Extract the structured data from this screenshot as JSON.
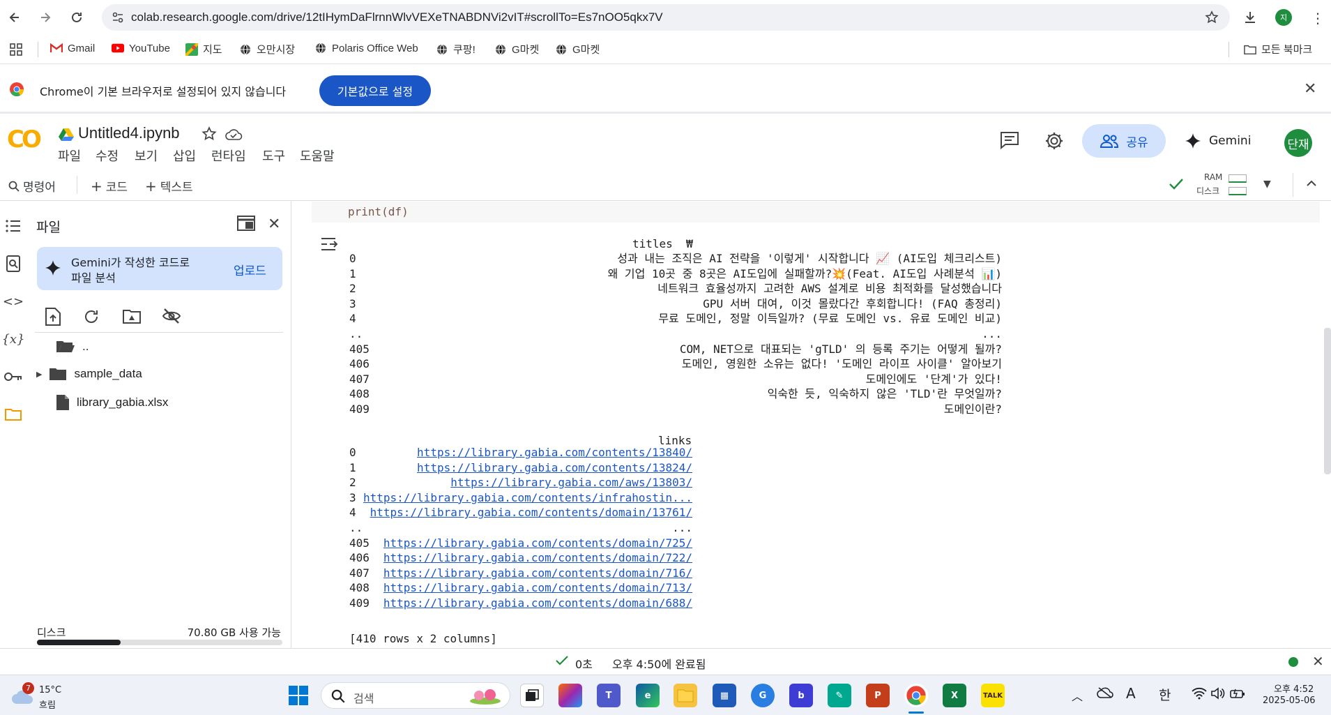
{
  "browser": {
    "url": "colab.research.google.com/drive/12tIHymDaFlrnnWlvVEXeTNABDNVi2vIT#scrollTo=Es7nOO5qkx7V",
    "profile_initial": "지"
  },
  "bookmarks": [
    {
      "label": "Gmail",
      "icon": "gmail-icon"
    },
    {
      "label": "YouTube",
      "icon": "youtube-icon"
    },
    {
      "label": "지도",
      "icon": "maps-icon"
    },
    {
      "label": "오만시장",
      "icon": "globe-icon"
    },
    {
      "label": "Polaris Office Web",
      "icon": "globe-icon"
    },
    {
      "label": "쿠팡!",
      "icon": "globe-icon"
    },
    {
      "label": "G마켓",
      "icon": "globe-icon"
    },
    {
      "label": "G마켓",
      "icon": "globe-icon"
    }
  ],
  "all_bookmarks_label": "모든 북마크",
  "infobar": {
    "message": "Chrome이 기본 브라우저로 설정되어 있지 않습니다",
    "button": "기본값으로 설정"
  },
  "colab": {
    "logo": "CO",
    "title": "Untitled4.ipynb",
    "menus": [
      "파일",
      "수정",
      "보기",
      "삽입",
      "런타임",
      "도구",
      "도움말"
    ],
    "share_label": "공유",
    "gemini_label": "Gemini",
    "avatar_label": "단재",
    "toolbar": {
      "command": "명령어",
      "code": "코드",
      "text": "텍스트",
      "ram": "RAM",
      "disk": "디스크"
    }
  },
  "sidebar": {
    "title": "파일",
    "gemini_card": {
      "line1": "Gemini가 작성한 코드로",
      "line2": "파일 분석",
      "upload": "업로드"
    },
    "tree": [
      {
        "name": "..",
        "type": "folder-open"
      },
      {
        "name": "sample_data",
        "type": "folder"
      },
      {
        "name": "library_gabia.xlsx",
        "type": "file"
      }
    ],
    "disk_label": "디스크",
    "disk_available": "70.80 GB 사용 가능",
    "disk_used_fraction": 0.34
  },
  "cell": {
    "code_line": "print(df)",
    "titles_header": "titles  ₩",
    "titles": [
      {
        "idx": "0",
        "text": "성과 내는 조직은 AI 전략을 '이렇게' 시작합니다 📈 (AI도입 체크리스트)"
      },
      {
        "idx": "1",
        "text": "왜 기업 10곳 중 8곳은 AI도입에 실패할까?💥(Feat. AI도입 사례분석 📊)"
      },
      {
        "idx": "2",
        "text": "네트워크 효율성까지 고려한 AWS 설계로 비용 최적화를 달성했습니다"
      },
      {
        "idx": "3",
        "text": "GPU 서버 대여, 이것 몰랐다간 후회합니다! (FAQ 총정리)"
      },
      {
        "idx": "4",
        "text": "무료 도메인, 정말 이득일까? (무료 도메인 vs. 유료 도메인 비교)"
      },
      {
        "idx": "..",
        "text": "..."
      },
      {
        "idx": "405",
        "text": "COM, NET으로 대표되는 'gTLD' 의 등록 주기는 어떻게 될까?"
      },
      {
        "idx": "406",
        "text": "도메인, 영원한 소유는 없다! '도메인 라이프 사이클' 알아보기"
      },
      {
        "idx": "407",
        "text": "도메인에도 '단계'가 있다!"
      },
      {
        "idx": "408",
        "text": "익숙한 듯, 익숙하지 않은 'TLD'란 무엇일까?"
      },
      {
        "idx": "409",
        "text": "도메인이란?"
      }
    ],
    "links_header": "links",
    "links": [
      {
        "idx": "0",
        "text": "https://library.gabia.com/contents/13840/",
        "link": true
      },
      {
        "idx": "1",
        "text": "https://library.gabia.com/contents/13824/",
        "link": true
      },
      {
        "idx": "2",
        "text": "https://library.gabia.com/aws/13803/",
        "link": true
      },
      {
        "idx": "3",
        "text": "https://library.gabia.com/contents/infrahostin...",
        "link": true
      },
      {
        "idx": "4",
        "text": "https://library.gabia.com/contents/domain/13761/",
        "link": true
      },
      {
        "idx": "..",
        "text": "...",
        "link": false
      },
      {
        "idx": "405",
        "text": "https://library.gabia.com/contents/domain/725/",
        "link": true
      },
      {
        "idx": "406",
        "text": "https://library.gabia.com/contents/domain/722/",
        "link": true
      },
      {
        "idx": "407",
        "text": "https://library.gabia.com/contents/domain/716/",
        "link": true
      },
      {
        "idx": "408",
        "text": "https://library.gabia.com/contents/domain/713/",
        "link": true
      },
      {
        "idx": "409",
        "text": "https://library.gabia.com/contents/domain/688/",
        "link": true
      }
    ],
    "footer": "[410 rows x 2 columns]"
  },
  "status": {
    "elapsed": "0초",
    "completed": "오후 4:50에 완료됨"
  },
  "taskbar": {
    "weather_temp": "15°C",
    "weather_desc": "흐림",
    "weather_badge": "7",
    "search_placeholder": "검색",
    "ime_a": "A",
    "ime_han": "한",
    "time": "오후 4:52",
    "date": "2025-05-06"
  },
  "colors": {
    "accent": "#1a56c6",
    "link": "#1a55c8",
    "colab_orange": "#f9ab00",
    "status_green": "#1e8e3e"
  }
}
